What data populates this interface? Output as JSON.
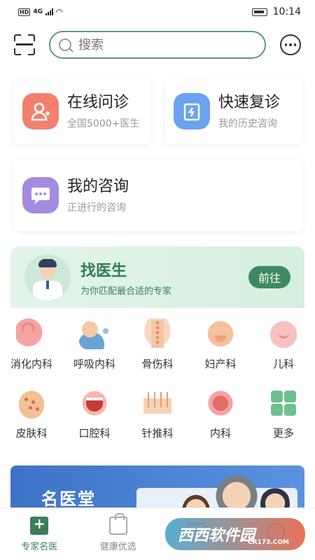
{
  "status_bar": {
    "network": "4G",
    "hd": "HD",
    "time": "10:14"
  },
  "search": {
    "placeholder": "搜索"
  },
  "cards": {
    "online_consult": {
      "title": "在线问诊",
      "subtitle": "全国5000+医生"
    },
    "quick_followup": {
      "title": "快速复诊",
      "subtitle": "我的历史咨询"
    },
    "my_consult": {
      "title": "我的咨询",
      "subtitle": "正进行的咨询"
    }
  },
  "find_doctor": {
    "title": "找医生",
    "subtitle": "为你匹配最合适的专家",
    "button": "前往"
  },
  "departments": [
    {
      "label": "消化内科",
      "icon": "stomach-icon"
    },
    {
      "label": "呼吸内科",
      "icon": "respiratory-icon"
    },
    {
      "label": "骨伤科",
      "icon": "spine-icon"
    },
    {
      "label": "妇产科",
      "icon": "pelvis-icon"
    },
    {
      "label": "儿科",
      "icon": "baby-icon"
    },
    {
      "label": "皮肤科",
      "icon": "hand-skin-icon"
    },
    {
      "label": "口腔科",
      "icon": "mouth-icon"
    },
    {
      "label": "针推科",
      "icon": "acupuncture-icon"
    },
    {
      "label": "内科",
      "icon": "intestine-icon"
    },
    {
      "label": "更多",
      "icon": "grid-icon"
    }
  ],
  "famous_banner": {
    "title": "名医堂"
  },
  "bottom_nav": [
    {
      "label": "专家名医",
      "active": true
    },
    {
      "label": "健康优选",
      "active": false
    }
  ],
  "watermark": {
    "brand": "西西软件园",
    "url": "CR173.COM"
  },
  "colors": {
    "accent": "#3c7d5a",
    "search_border": "#5a9a78",
    "consult": "#f3806f",
    "followup": "#6aa3ee",
    "mine": "#a58be0"
  }
}
